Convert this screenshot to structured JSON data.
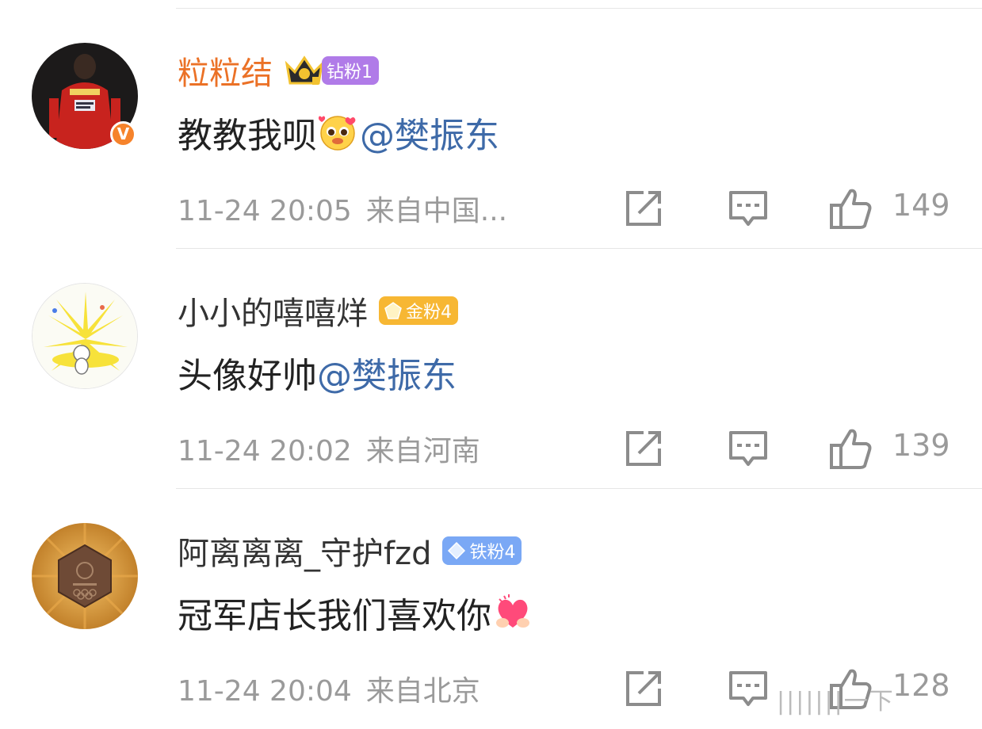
{
  "comments": [
    {
      "username": "粒粒结",
      "fan_badge": "钻粉1",
      "text": "教教我呗",
      "mention": "@樊振东",
      "time": "11-24 20:05",
      "location": "来自中国...",
      "likes": "149"
    },
    {
      "username": "小小的嘻嘻烊",
      "fan_badge": "金粉4",
      "text": "头像好帅",
      "mention": "@樊振东",
      "time": "11-24 20:02",
      "location": "来自河南",
      "likes": "139"
    },
    {
      "username": "阿离离离_守护fzd",
      "fan_badge": "铁粉4",
      "text": "冠军店长我们喜欢你",
      "mention": "",
      "time": "11-24 20:04",
      "location": "来自北京",
      "likes": "128"
    }
  ],
  "verified_badge": "V",
  "colors": {
    "vip_name": "#eb7126",
    "mention": "#3e6aa8",
    "diamond_fan": "#b07be8",
    "gold_fan": "#f7b733",
    "iron_fan": "#7aa8f5",
    "meta_text": "#9a9a9a"
  },
  "icons": [
    "share-icon",
    "reply-icon",
    "like-icon"
  ],
  "footer": "|||||||一下"
}
